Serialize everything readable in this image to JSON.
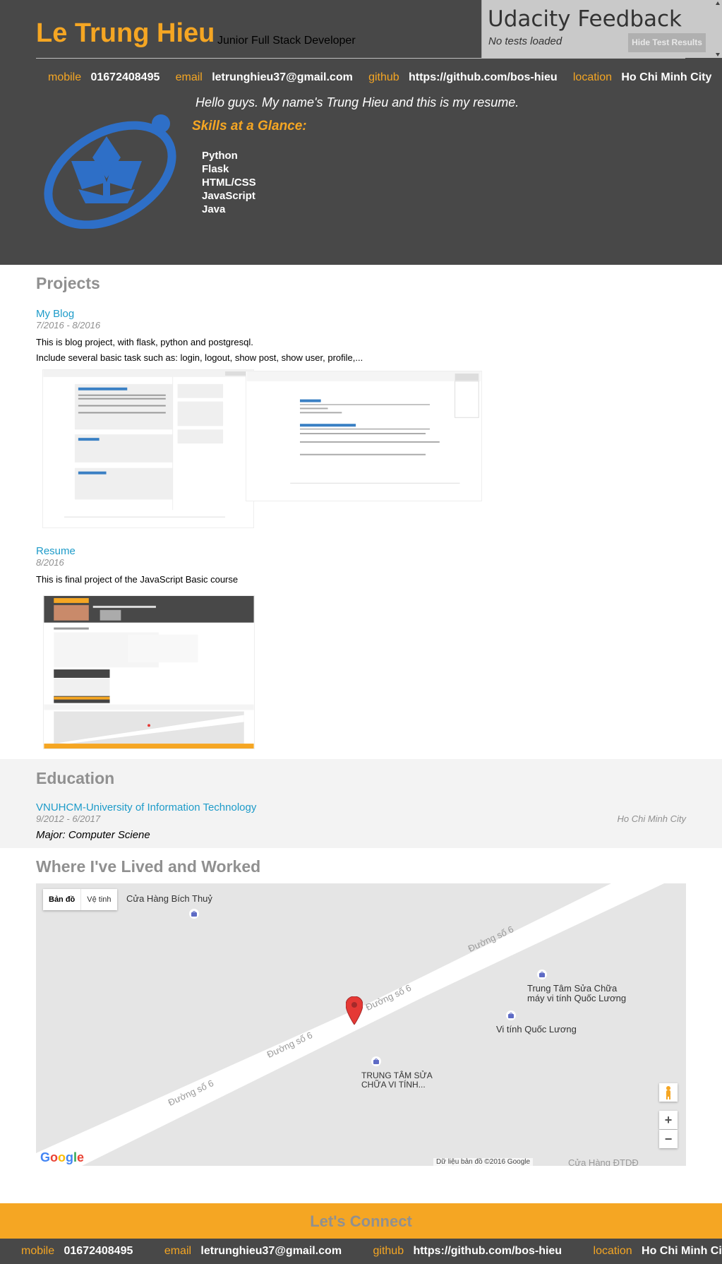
{
  "header": {
    "name": "Le Trung Hieu",
    "role": "Junior Full Stack Developer",
    "welcome": "Hello guys. My name's Trung Hieu and this is my resume.",
    "skills_title": "Skills at a Glance:",
    "skills": [
      "Python",
      "Flask",
      "HTML/CSS",
      "JavaScript",
      "Java"
    ]
  },
  "contacts": {
    "mobile_label": "mobile",
    "mobile": "01672408495",
    "email_label": "email",
    "email": "letrunghieu37@gmail.com",
    "github_label": "github",
    "github": "https://github.com/bos-hieu",
    "location_label": "location",
    "location": "Ho Chi Minh City"
  },
  "udacity": {
    "title": "Udacity Feedback",
    "status": "No tests loaded",
    "hide_button": "Hide Test Results"
  },
  "projects": {
    "title": "Projects",
    "items": [
      {
        "title": "My Blog",
        "dates": "7/2016 - 8/2016",
        "desc1": "This is blog project, with flask, python and postgresql.",
        "desc2": "Include several basic task such as: login, logout, show post, show user, profile,..."
      },
      {
        "title": "Resume",
        "dates": "8/2016",
        "desc1": "This is final project of the JavaScript Basic course"
      }
    ]
  },
  "education": {
    "title": "Education",
    "school": "VNUHCM-University of Information Technology",
    "dates": "9/2012 - 6/2017",
    "location": "Ho Chi Minh City",
    "major": "Major: Computer Sciene"
  },
  "map_section": {
    "title": "Where I've Lived and Worked",
    "tab_map": "Bản đồ",
    "tab_satellite": "Vệ tinh",
    "road_label": "Đường số 6",
    "place1": "Cửa Hàng Bích Thuỷ",
    "place2_line1": "Trung Tâm Sửa Chữa",
    "place2_line2": "máy vi tính Quốc Lương",
    "place3": "Vi tính Quốc Lương",
    "place4_line1": "TRUNG TÂM SỬA",
    "place4_line2": "CHỮA VI TÍNH...",
    "place5": "Cửa Hàng ĐTDĐ",
    "copyright": "Dữ liệu bản đồ ©2016 Google",
    "google": "Google",
    "zoom_in": "+",
    "zoom_out": "−"
  },
  "footer": {
    "title": "Let's Connect"
  }
}
